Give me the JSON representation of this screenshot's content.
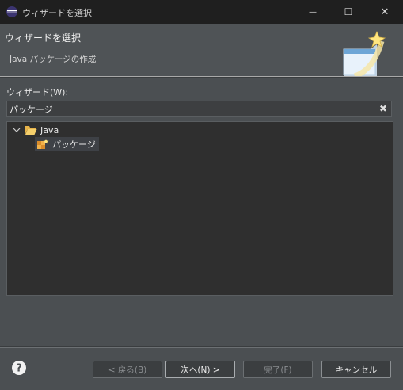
{
  "window": {
    "title": "ウィザードを選択",
    "min_glyph": "—",
    "max_glyph": "☐",
    "close_glyph": "✕"
  },
  "header": {
    "title": "ウィザードを選択",
    "subtitle": "Java パッケージの作成"
  },
  "wizard": {
    "label": "ウィザード(W):",
    "filter_value": "パッケージ"
  },
  "tree": {
    "nodes": [
      {
        "label": "Java",
        "icon": "folder-open-icon",
        "expanded": true
      },
      {
        "label": "パッケージ",
        "icon": "package-wizard-icon",
        "selected": true
      }
    ]
  },
  "buttons": {
    "back": "< 戻る(B)",
    "next": "次へ(N) >",
    "finish": "完了(F)",
    "cancel": "キャンセル"
  },
  "colors": {
    "titlebar": "#1f1f1f",
    "background": "#4b4f52",
    "tree_bg": "#2f2f2f"
  }
}
